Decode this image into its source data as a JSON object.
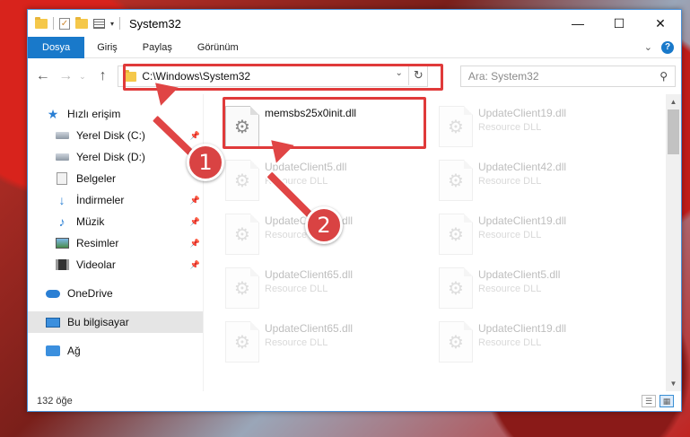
{
  "window": {
    "title": "System32",
    "min_glyph": "—",
    "max_glyph": "☐",
    "close_glyph": "✕"
  },
  "ribbon": {
    "tabs": [
      "Dosya",
      "Giriş",
      "Paylaş",
      "Görünüm"
    ],
    "expand_glyph": "⌄",
    "help_glyph": "?"
  },
  "nav": {
    "back_glyph": "←",
    "forward_glyph": "→",
    "recent_glyph": "⌄",
    "up_glyph": "↑",
    "address": "C:\\Windows\\System32",
    "address_dd_glyph": "⌄",
    "refresh_glyph": "↻",
    "search_placeholder": "Ara: System32",
    "search_glyph": "⚲"
  },
  "sidebar": {
    "quick_access": "Hızlı erişim",
    "items": [
      {
        "label": "Yerel Disk (C:)",
        "icon": "drive-icon"
      },
      {
        "label": "Yerel Disk (D:)",
        "icon": "drive-icon"
      },
      {
        "label": "Belgeler",
        "icon": "documents-icon"
      },
      {
        "label": "İndirmeler",
        "icon": "downloads-icon"
      },
      {
        "label": "Müzik",
        "icon": "music-icon"
      },
      {
        "label": "Resimler",
        "icon": "pictures-icon"
      },
      {
        "label": "Videolar",
        "icon": "videos-icon"
      }
    ],
    "onedrive": "OneDrive",
    "this_pc": "Bu bilgisayar",
    "network": "Ağ"
  },
  "files": [
    {
      "name": "memsbs25x0init.dll",
      "type": ""
    },
    {
      "name": "UpdateClient19.dll",
      "type": "Resource DLL"
    },
    {
      "name": "UpdateClient5.dll",
      "type": "Resource DLL"
    },
    {
      "name": "UpdateClient42.dll",
      "type": "Resource DLL"
    },
    {
      "name": "UpdateClient42.dll",
      "type": "Resource DLL"
    },
    {
      "name": "UpdateClient19.dll",
      "type": "Resource DLL"
    },
    {
      "name": "UpdateClient65.dll",
      "type": "Resource DLL"
    },
    {
      "name": "UpdateClient5.dll",
      "type": "Resource DLL"
    },
    {
      "name": "UpdateClient65.dll",
      "type": "Resource DLL"
    },
    {
      "name": "UpdateClient19.dll",
      "type": "Resource DLL"
    }
  ],
  "status": {
    "count": "132 öğe"
  },
  "annotations": {
    "badge1": "1",
    "badge2": "2",
    "accent": "#e03a3a"
  }
}
